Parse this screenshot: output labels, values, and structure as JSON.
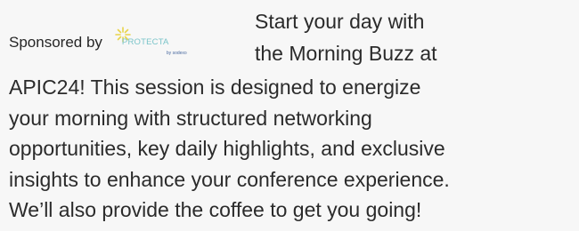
{
  "sponsor": {
    "label": "Sponsored by",
    "logo_text": "PROTECTA",
    "logo_subtext": "by sodexo",
    "logo_colors": {
      "sparkle": "#e8d44a",
      "text": "#7ac4c9",
      "subtext": "#4a6aa0"
    }
  },
  "heading_lines": [
    "Start your day with",
    "the Morning Buzz at"
  ],
  "body_lines": [
    "APIC24! This session is designed to energize",
    "your morning with structured networking",
    "opportunities, key daily highlights, and exclusive",
    "insights to enhance your conference experience.",
    "We’ll also provide the coffee to get you going!"
  ]
}
